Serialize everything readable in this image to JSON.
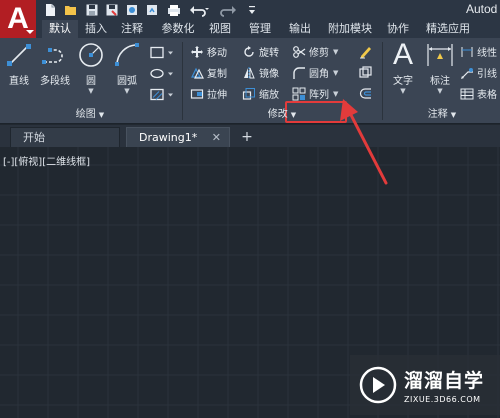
{
  "window": {
    "title": "Autod"
  },
  "app_menu": {
    "logo": "A"
  },
  "quick_access": [
    "new-file-icon",
    "open-folder-icon",
    "save-icon",
    "save-as-icon",
    "web-open-icon",
    "web-save-icon",
    "print-icon",
    "undo-icon",
    "redo-icon",
    "customize-dropdown-icon"
  ],
  "ribbon_tabs": [
    {
      "label": "默认",
      "active": true
    },
    {
      "label": "插入"
    },
    {
      "label": "注释"
    },
    {
      "label": "参数化"
    },
    {
      "label": "视图"
    },
    {
      "label": "管理"
    },
    {
      "label": "输出"
    },
    {
      "label": "附加模块"
    },
    {
      "label": "协作"
    },
    {
      "label": "精选应用"
    }
  ],
  "draw_panel": {
    "title": "绘图",
    "tools": {
      "line": "直线",
      "polyline": "多段线",
      "circle": "圆",
      "arc": "圆弧"
    }
  },
  "modify_panel": {
    "title": "修改",
    "tools": {
      "move": "移动",
      "rotate": "旋转",
      "trim": "修剪",
      "copy": "复制",
      "mirror": "镜像",
      "fillet": "圆角",
      "stretch": "拉伸",
      "scale": "缩放",
      "array": "阵列"
    }
  },
  "annotation_panel": {
    "title": "注释",
    "tools": {
      "text": "文字",
      "dimension": "标注",
      "linear": "线性",
      "leader": "引线",
      "table": "表格"
    }
  },
  "doc_tabs": {
    "start": "开始",
    "drawing": "Drawing1*",
    "new_tab": "+"
  },
  "viewport": {
    "label": "[-][俯视][二维线框]"
  },
  "watermark": {
    "main": "溜溜自学",
    "sub": "ZIXUE.3D66.COM"
  },
  "colors": {
    "accent_red": "#e23b3b",
    "app_button": "#b21e23",
    "ribbon_bg": "#3b4554",
    "canvas_bg": "#212830"
  }
}
